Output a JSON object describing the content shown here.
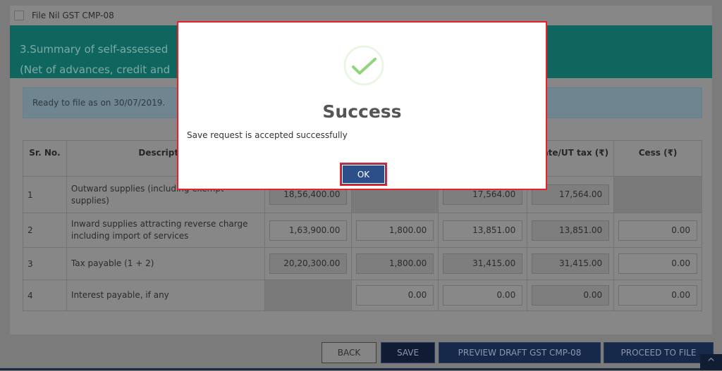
{
  "nil_checkbox": {
    "label": "File Nil GST CMP-08",
    "checked": false
  },
  "section": {
    "title_line1": "3.Summary of self-assessed",
    "title_line2": "(Net of advances, credit and"
  },
  "info": "Ready to file as on 30/07/2019.",
  "table": {
    "headers": [
      "Sr. No.",
      "Description",
      "",
      "",
      "",
      "State/UT tax (₹)",
      "Cess (₹)"
    ],
    "rows": [
      {
        "sr": "1",
        "desc": "Outward supplies (including exempt supplies)",
        "cells": [
          "18,56,400.00",
          null,
          "17,564.00",
          "17,564.00",
          null
        ]
      },
      {
        "sr": "2",
        "desc": "Inward supplies attracting reverse charge including import of services",
        "cells": [
          "1,63,900.00",
          "1,800.00",
          "13,851.00",
          "13,851.00",
          "0.00"
        ]
      },
      {
        "sr": "3",
        "desc": "Tax payable (1 + 2)",
        "cells": [
          "20,20,300.00",
          "1,800.00",
          "31,415.00",
          "31,415.00",
          "0.00"
        ]
      },
      {
        "sr": "4",
        "desc": "Interest payable, if any",
        "cells": [
          null,
          "0.00",
          "0.00",
          "0.00",
          "0.00"
        ]
      }
    ]
  },
  "buttons": {
    "back": "BACK",
    "save": "SAVE",
    "preview": "PREVIEW DRAFT GST CMP-08",
    "proceed": "PROCEED TO FILE",
    "to_top": "^"
  },
  "modal": {
    "title": "Success",
    "message": "Save request is accepted successfully",
    "ok": "OK",
    "icon": "check-circle-icon",
    "accent": "#8fd67a",
    "highlight": "#e8202a"
  }
}
